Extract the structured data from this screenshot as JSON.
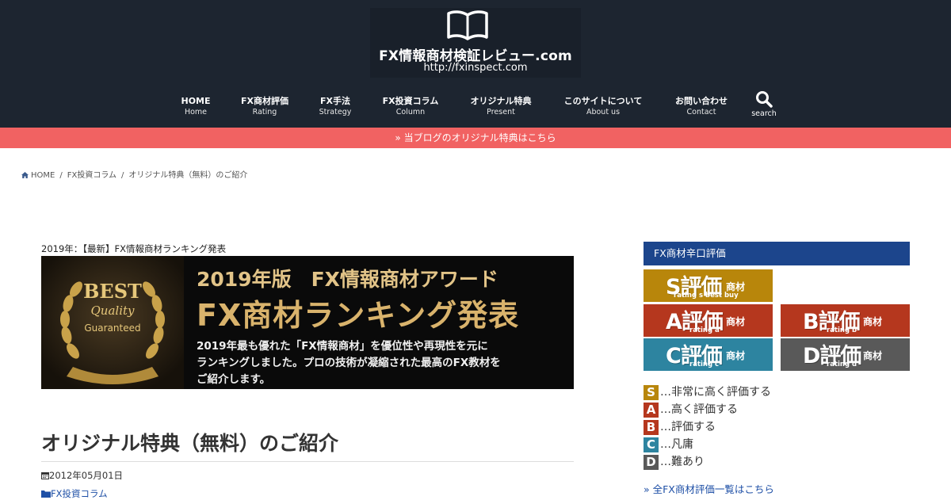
{
  "header": {
    "logo_title": "FX情報商材検証レビュー.com",
    "logo_url": "http://fxinspect.com",
    "nav": [
      {
        "jp": "HOME",
        "en": "Home"
      },
      {
        "jp": "FX商材評価",
        "en": "Rating"
      },
      {
        "jp": "FX手法",
        "en": "Strategy"
      },
      {
        "jp": "FX投資コラム",
        "en": "Column"
      },
      {
        "jp": "オリジナル特典",
        "en": "Present"
      },
      {
        "jp": "このサイトについて",
        "en": "About us"
      },
      {
        "jp": "お問い合わせ",
        "en": "Contact"
      }
    ],
    "search_label": "search",
    "notice": "» 当ブログのオリジナル特典はこちら"
  },
  "breadcrumb": {
    "home": "HOME",
    "sep": "/",
    "category": "FX投資コラム",
    "current": "オリジナル特典（無料）のご紹介"
  },
  "main": {
    "banner_caption": "2019年：【最新】FX情報商材ランキング発表",
    "banner": {
      "badge_best": "BEST",
      "badge_quality": "Quality",
      "badge_guaranteed": "Guaranteed",
      "title1": "2019年版　FX情報商材アワード",
      "title2": "FX商材ランキング発表",
      "desc_line1": "2019年最も優れた「FX情報商材」を優位性や再現性を元に",
      "desc_line2": "ランキングしました。プロの技術が凝縮された最高のFX教材を",
      "desc_line3": "ご紹介します。"
    },
    "title": "オリジナル特典（無料）のご紹介",
    "date": "2012年05月01日",
    "category": "FX投資コラム"
  },
  "sidebar": {
    "widget_title": "FX商材辛口評価",
    "ratings": [
      {
        "letter": "S評価",
        "suffix": "商材",
        "sub": "rating s best buy"
      },
      {
        "letter": "A評価",
        "suffix": "商材",
        "sub": "rating a"
      },
      {
        "letter": "B評価",
        "suffix": "商材",
        "sub": "rating b"
      },
      {
        "letter": "C評価",
        "suffix": "商材",
        "sub": "rating c"
      },
      {
        "letter": "D評価",
        "suffix": "商材",
        "sub": "rating d"
      }
    ],
    "legend": [
      {
        "badge": "S",
        "text": "…非常に高く評価する",
        "color": "#b8860b"
      },
      {
        "badge": "A",
        "text": "…高く評価する",
        "color": "#b5371e"
      },
      {
        "badge": "B",
        "text": "…評価する",
        "color": "#b5371e"
      },
      {
        "badge": "C",
        "text": "…凡庸",
        "color": "#2d84a0"
      },
      {
        "badge": "D",
        "text": "…難あり",
        "color": "#595959"
      }
    ],
    "all_link": "» 全FX商材評価一覧はこちら"
  }
}
